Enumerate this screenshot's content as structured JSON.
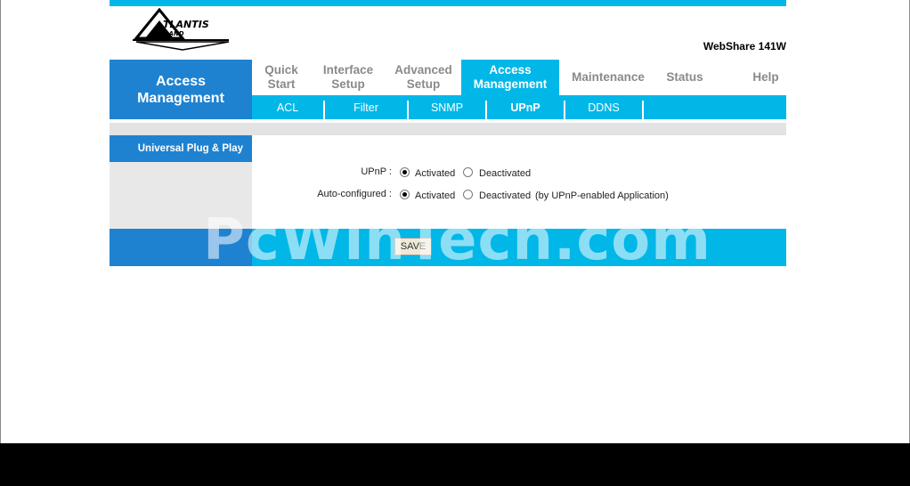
{
  "header": {
    "logo_text": "ATLANTIS LAND",
    "model": "WebShare 141W"
  },
  "nav": {
    "section_title_line1": "Access",
    "section_title_line2": "Management",
    "tabs": [
      {
        "line1": "Quick",
        "line2": "Start"
      },
      {
        "line1": "Interface",
        "line2": "Setup"
      },
      {
        "line1": "Advanced",
        "line2": "Setup"
      },
      {
        "line1": "Access",
        "line2": "Management",
        "active": true
      },
      {
        "line1": "Maintenance",
        "line2": ""
      },
      {
        "line1": "Status",
        "line2": ""
      },
      {
        "line1": "Help",
        "line2": ""
      }
    ],
    "subtabs": [
      "ACL",
      "Filter",
      "SNMP",
      "UPnP",
      "DDNS"
    ]
  },
  "side": {
    "label": "Universal Plug & Play"
  },
  "form": {
    "upnp_label": "UPnP :",
    "upnp_activated": "Activated",
    "upnp_deactivated": "Deactivated",
    "upnp_value": "Activated",
    "auto_label": "Auto-configured :",
    "auto_activated": "Activated",
    "auto_deactivated": "Deactivated",
    "auto_value": "Activated",
    "auto_note": "(by UPnP-enabled Application)"
  },
  "save_label": "SAVE",
  "watermark": "PcWinTech.com",
  "colors": {
    "accent_cyan": "#00b7e8",
    "accent_blue": "#1e82d0"
  }
}
